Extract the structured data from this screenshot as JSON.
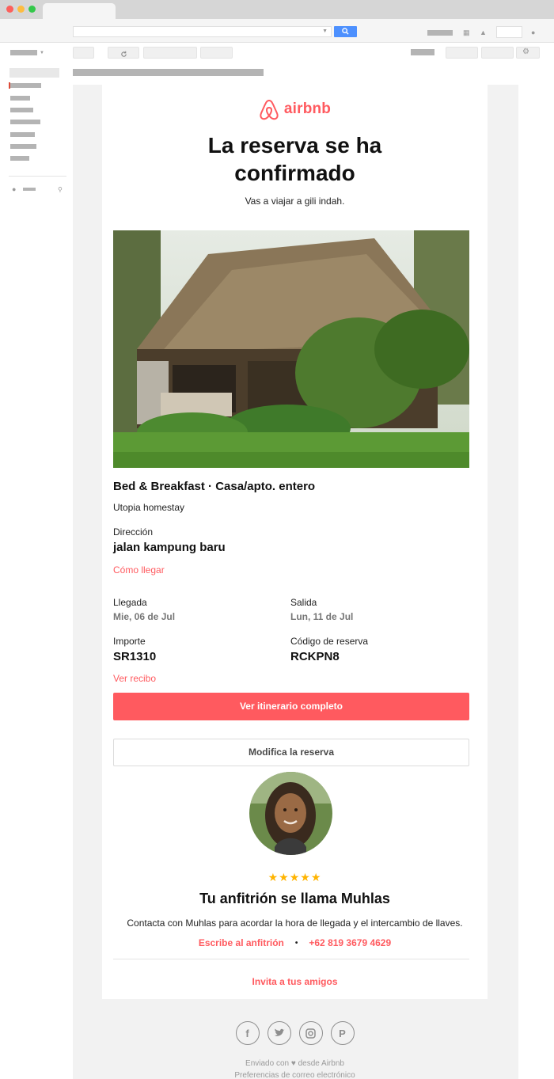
{
  "colors": {
    "brand": "#ff5a5f",
    "star": "#ffb400"
  },
  "email": {
    "logo_text": "airbnb",
    "title": "La reserva se ha confirmado",
    "subtitle": "Vas a viajar a gili indah.",
    "listing_type": "Bed & Breakfast · Casa/apto. entero",
    "listing_name": "Utopia homestay",
    "address_label": "Dirección",
    "address_value": "jalan kampung baru",
    "directions_link": "Cómo llegar",
    "checkin_label": "Llegada",
    "checkin_value": "Mie, 06 de Jul",
    "checkout_label": "Salida",
    "checkout_value": "Lun, 11 de Jul",
    "amount_label": "Importe",
    "amount_value": "SR1310",
    "code_label": "Código de reserva",
    "code_value": "RCKPN8",
    "receipt_link": "Ver recibo",
    "itinerary_button": "Ver itinerario completo",
    "modify_button": "Modifica la reserva",
    "stars": "★★★★★",
    "host_heading": "Tu anfitrión se llama Muhlas",
    "host_desc": "Contacta con Muhlas para acordar la hora de llegada y el intercambio de llaves.",
    "write_host_link": "Escribe al anfitrión",
    "separator": "•",
    "host_phone": "+62 819 3679 4629",
    "invite_link": "Invita a tus amigos",
    "footer_sent": "Enviado con ♥ desde Airbnb",
    "footer_prefs": "Preferencias de correo electrónico"
  },
  "social_icons": [
    "facebook-icon",
    "twitter-icon",
    "instagram-icon",
    "pinterest-icon"
  ]
}
